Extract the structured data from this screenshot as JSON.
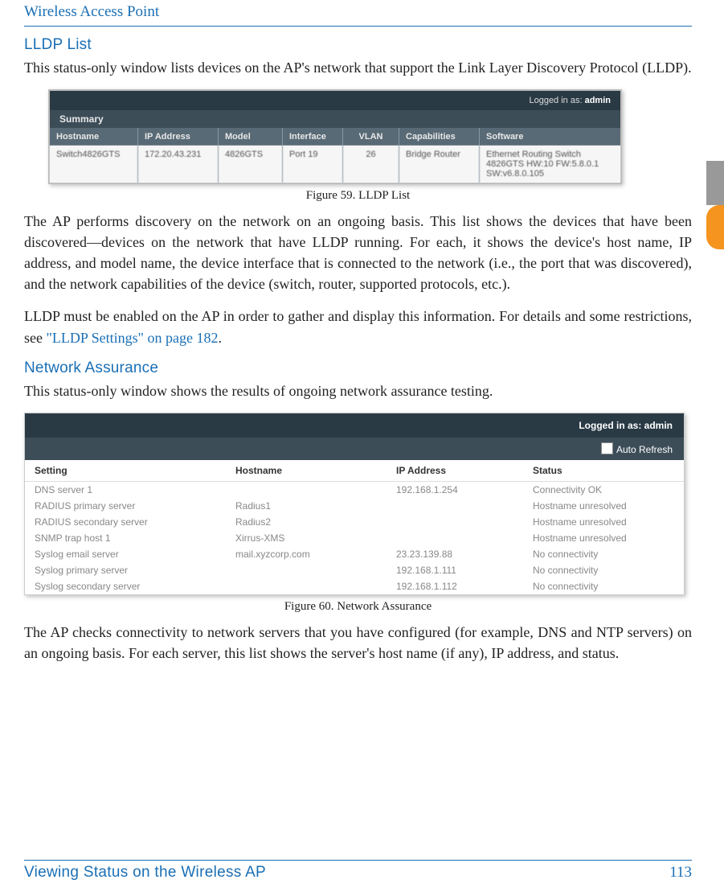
{
  "header": {
    "title": "Wireless Access Point"
  },
  "section1": {
    "heading": "LLDP List",
    "para1": "This status-only window lists devices on the AP's network that support the Link Layer Discovery Protocol (LLDP).",
    "caption": "Figure 59. LLDP List",
    "para2": "The AP performs discovery on the network on an ongoing basis. This list shows the devices that have been discovered—devices on the network that have LLDP running. For each, it shows the device's host name, IP address, and model name, the device interface that is connected to the network (i.e., the port that was discovered), and the network capabilities of the device (switch, router, supported protocols, etc.).",
    "para3a": "LLDP must be enabled on the AP in order to gather and display this information. For details and some restrictions, see ",
    "para3link": "\"LLDP Settings\" on page 182",
    "para3b": "."
  },
  "fig59": {
    "logged_label": "Logged in as:",
    "logged_user": "admin",
    "summary_label": "Summary",
    "columns": [
      "Hostname",
      "IP Address",
      "Model",
      "Interface",
      "VLAN",
      "Capabilities",
      "Software"
    ],
    "row": {
      "hostname": "Switch4826GTS",
      "ip": "172.20.43.231",
      "model": "4826GTS",
      "iface": "Port 19",
      "vlan": "26",
      "cap": "Bridge Router",
      "sw": "Ethernet Routing Switch 4826GTS HW:10 FW:5.8.0.1 SW:v6.8.0.105"
    }
  },
  "section2": {
    "heading": "Network Assurance",
    "para1": "This status-only window shows the results of ongoing network assurance testing.",
    "caption": "Figure 60. Network Assurance",
    "para2": "The AP checks connectivity to network servers that you have configured (for example, DNS and NTP servers) on an ongoing basis. For each server, this list shows the server's host name (if any), IP address, and status."
  },
  "fig60": {
    "logged": "Logged in as: admin",
    "auto_refresh": "Auto Refresh",
    "columns": [
      "Setting",
      "Hostname",
      "IP Address",
      "Status"
    ],
    "rows": [
      {
        "setting": "DNS server 1",
        "host": "",
        "ip": "192.168.1.254",
        "status": "Connectivity OK"
      },
      {
        "setting": "RADIUS primary server",
        "host": "Radius1",
        "ip": "",
        "status": "Hostname unresolved"
      },
      {
        "setting": "RADIUS secondary server",
        "host": "Radius2",
        "ip": "",
        "status": "Hostname unresolved"
      },
      {
        "setting": "SNMP trap host 1",
        "host": "Xirrus-XMS",
        "ip": "",
        "status": "Hostname unresolved"
      },
      {
        "setting": "Syslog email server",
        "host": "mail.xyzcorp.com",
        "ip": "23.23.139.88",
        "status": "No connectivity"
      },
      {
        "setting": "Syslog primary server",
        "host": "",
        "ip": "192.168.1.111",
        "status": "No connectivity"
      },
      {
        "setting": "Syslog secondary server",
        "host": "",
        "ip": "192.168.1.112",
        "status": "No connectivity"
      }
    ]
  },
  "footer": {
    "left": "Viewing Status on the Wireless AP",
    "page": "113"
  }
}
